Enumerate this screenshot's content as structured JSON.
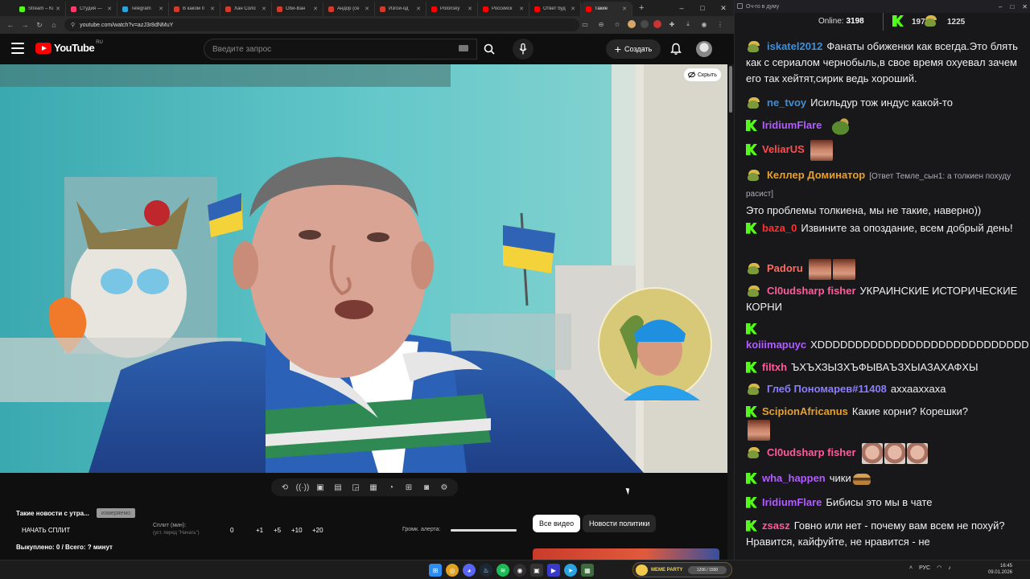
{
  "browser": {
    "tabs": [
      {
        "label": "Stream – Ki",
        "color": "#53fc18"
      },
      {
        "label": "Студия —",
        "color": "#ff3b6b"
      },
      {
        "label": "Telegram",
        "color": "#2aa3e0"
      },
      {
        "label": "В каком п",
        "color": "#d43a2a"
      },
      {
        "label": "Хан Соло",
        "color": "#d43a2a"
      },
      {
        "label": "Оби-Ван",
        "color": "#d43a2a"
      },
      {
        "label": "Андор (се",
        "color": "#d43a2a"
      },
      {
        "label": "Изгой-од",
        "color": "#d43a2a"
      },
      {
        "label": "Polonsky",
        "color": "#ff0000"
      },
      {
        "label": "Российск",
        "color": "#ff0000"
      },
      {
        "label": "Ответ буд",
        "color": "#ff0000"
      },
      {
        "label": "Такие",
        "color": "#ff0000",
        "active": true
      }
    ],
    "url": "youtube.com/watch?v=azJ3r8dNMuY",
    "window_controls": [
      "–",
      "□",
      "✕"
    ]
  },
  "yt": {
    "logo_text": "YouTube",
    "region": "RU",
    "search_placeholder": "Введите запрос",
    "create_label": "Создать",
    "hide_label": "Скрыть"
  },
  "panel": {
    "news_title": "Такие новости с утра...",
    "news_badge": "измеряемо",
    "split_start": "НАЧАТЬ СПЛИТ",
    "split_label": "Сплит (мин):",
    "split_hint": "(уст. перед \"Начать\")",
    "split_values": [
      "0",
      "+1",
      "+5",
      "+10",
      "+20"
    ],
    "volume_label": "Громк. алерта:",
    "volume_level": 1.0,
    "bought": "Выкуплено: 0 / Всего: ? минут",
    "chip_all": "Все видео",
    "chip_politics": "Новости политики"
  },
  "chat": {
    "window_title": "Оч-го в думу",
    "online_label": "Online:",
    "online_count": "3198",
    "kick_count": "1973",
    "other_count": "1225",
    "messages": [
      {
        "badge": "pepe",
        "user": "iskatel2012",
        "color": "#3f8ed8",
        "text": "Фанаты обиженки как всегда.Это блять как с сериалом чернобыль,в свое время охуевал зачем его так хейтят,сирик ведь хороший."
      },
      {
        "badge": "pepe",
        "user": "ne_tvoy",
        "color": "#3f8ed8",
        "text": "Исильдур тож индус какой-то"
      },
      {
        "badge": "kick",
        "user": "IridiumFlare",
        "color": "#b05cff",
        "text": "",
        "emote": "frog"
      },
      {
        "badge": "kick",
        "user": "VeliarUS",
        "color": "#ff4d4d",
        "text": "",
        "emote": "face"
      },
      {
        "badge": "pepe",
        "user": "Келлер Доминатор",
        "color": "#e8a02a",
        "reply": "[Ответ Темле_сын1: а толкиен похуду расист]",
        "text": "Это проблемы толкиена, мы не такие, наверно))"
      },
      {
        "badge": "kick",
        "user": "baza_0",
        "color": "#ff3030",
        "text": "Извините за опоздание, всем добрый день!"
      },
      {
        "badge": "pepe",
        "user": "Padoru",
        "color": "#ff6a5e",
        "text": "",
        "emote": "face2x"
      },
      {
        "badge": "pepe",
        "user": "Cl0udsharp fisher",
        "color": "#ff5b9a",
        "text": "УКРАИНСКИЕ ИСТОРИЧЕСКИЕ КОРНИ"
      },
      {
        "badge": "kick",
        "user": "koiiimapuyc",
        "color": "#b05cff",
        "text": "XDDDDDDDDDDDDDDDDDDDDDDDDDDDD"
      },
      {
        "badge": "kick",
        "user": "filtxh",
        "color": "#ff5b9a",
        "text": "ЪХЪХЗЫЗХЪФЫВАЪЗХЫАЗАХАФХЫ"
      },
      {
        "badge": "pepe",
        "user": "Глеб Пономарев#11408",
        "color": "#8a7dff",
        "text": "аххаахxaxa"
      },
      {
        "badge": "kick",
        "user": "ScipionAfricanus",
        "color": "#e8a02a",
        "text": "Какие корни? Корешки?"
      },
      {
        "badge": "pepe",
        "user": "Cl0udsharp fisher",
        "color": "#ff5b9a",
        "text": "",
        "emote": "face3x"
      },
      {
        "badge": "kick",
        "user": "wha_happen",
        "color": "#b05cff",
        "text": "чики"
      },
      {
        "badge": "kick",
        "user": "IridiumFlare",
        "color": "#b05cff",
        "text": "Бибисы это мы в чате"
      },
      {
        "badge": "kick",
        "user": "zsasz",
        "color": "#ff5b9a",
        "text": "Говно или нет - почему вам всем не похуй? Нравится, кайфуйте, не нравится - не"
      }
    ]
  },
  "taskbar": {
    "meme_label": "MEME PARTY",
    "meme_progress": "1206 / 1500",
    "tray_lang": "РУС",
    "time": "16:45",
    "date": "09.01.2026"
  }
}
